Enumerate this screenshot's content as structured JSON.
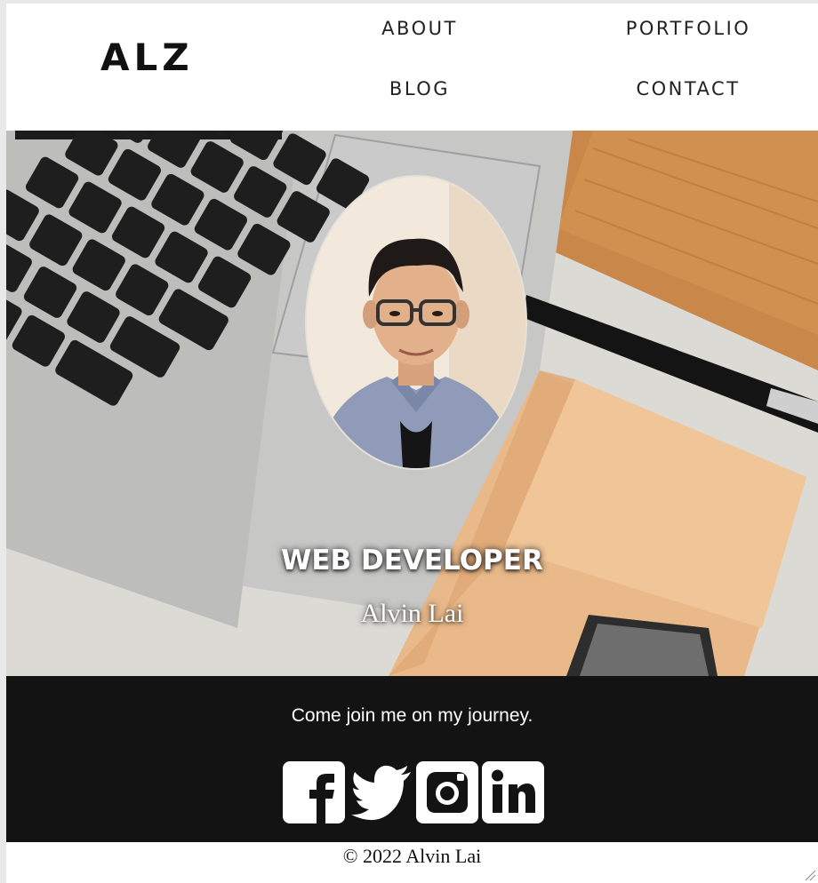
{
  "brand": {
    "logo": "ALZ"
  },
  "nav": {
    "about": "ABOUT",
    "portfolio": "PORTFOLIO",
    "blog": "BLOG",
    "contact": "CONTACT"
  },
  "hero": {
    "title": "WEB DEVELOPER",
    "name": "Alvin Lai"
  },
  "band": {
    "tagline": "Come join me on my journey.",
    "social": [
      {
        "icon": "facebook-icon"
      },
      {
        "icon": "twitter-icon"
      },
      {
        "icon": "instagram-icon"
      },
      {
        "icon": "linkedin-icon"
      }
    ]
  },
  "footer": {
    "copyright": "© 2022 Alvin Lai"
  },
  "colors": {
    "band_bg": "#131313",
    "text_light": "#ffffff",
    "text_dark": "#111111"
  }
}
